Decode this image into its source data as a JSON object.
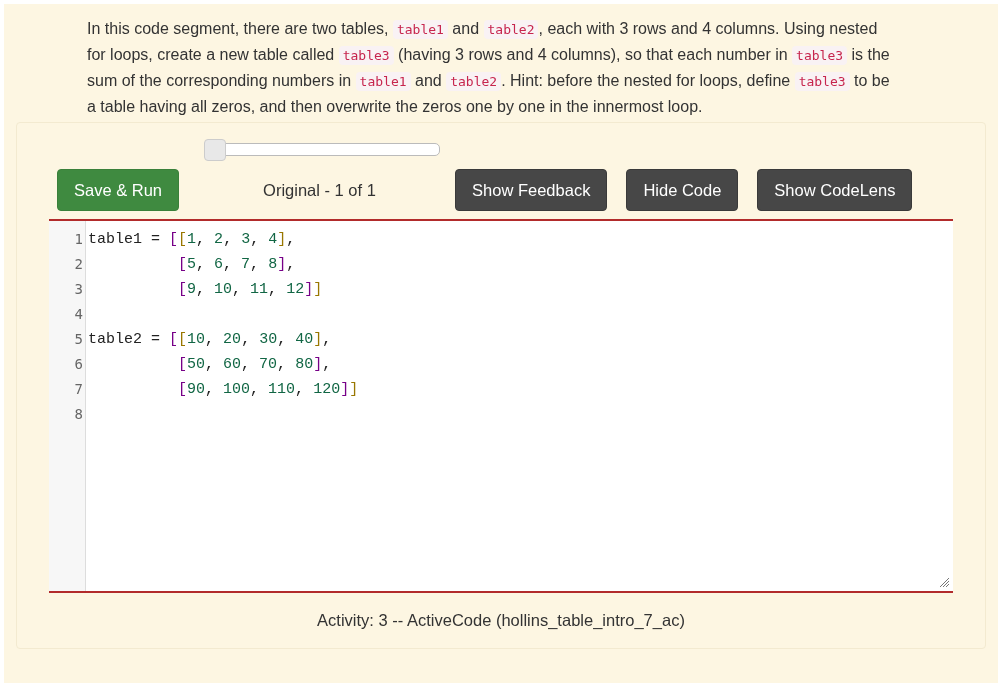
{
  "prompt": [
    {
      "kind": "text",
      "text": "In this code segment, there are two tables, "
    },
    {
      "kind": "code",
      "text": "table1"
    },
    {
      "kind": "text",
      "text": " and "
    },
    {
      "kind": "code",
      "text": "table2"
    },
    {
      "kind": "text",
      "text": ", each with 3 rows and 4 columns. Using nested for loops, create a new table called "
    },
    {
      "kind": "code",
      "text": "table3"
    },
    {
      "kind": "text",
      "text": " (having 3 rows and 4 columns), so that each number in "
    },
    {
      "kind": "code",
      "text": "table3"
    },
    {
      "kind": "text",
      "text": " is the sum of the corresponding numbers in "
    },
    {
      "kind": "code",
      "text": "table1"
    },
    {
      "kind": "text",
      "text": " and "
    },
    {
      "kind": "code",
      "text": "table2"
    },
    {
      "kind": "text",
      "text": ". Hint: before the nested for loops, define "
    },
    {
      "kind": "code",
      "text": "table3"
    },
    {
      "kind": "text",
      "text": " to be a table having all zeros, and then overwrite the zeros one by one in the innermost loop."
    }
  ],
  "history_slider": {
    "level": 0
  },
  "buttons": [
    {
      "label": "Save & Run",
      "kind": "primary"
    },
    {
      "label": "Show Feedback",
      "kind": "dark"
    },
    {
      "label": "Hide Code",
      "kind": "dark"
    },
    {
      "label": "Show CodeLens",
      "kind": "dark"
    }
  ],
  "version_label": "Original - 1 of 1",
  "editor": {
    "lines": [
      {
        "number": "1",
        "code": "table1 = [[1, 2, 3, 4],"
      },
      {
        "number": "2",
        "code": "          [5, 6, 7, 8],"
      },
      {
        "number": "3",
        "code": "          [9, 10, 11, 12]]"
      },
      {
        "number": "4"
      },
      {
        "number": "5",
        "code": "table2 = [[10, 20, 30, 40],"
      },
      {
        "number": "6",
        "code": "          [50, 60, 70, 80],"
      },
      {
        "number": "7",
        "code": "          [90, 100, 110, 120]]"
      },
      {
        "number": "8"
      }
    ]
  },
  "caption": "Activity: 3 -- ActiveCode (hollins_table_intro_7_ac)"
}
